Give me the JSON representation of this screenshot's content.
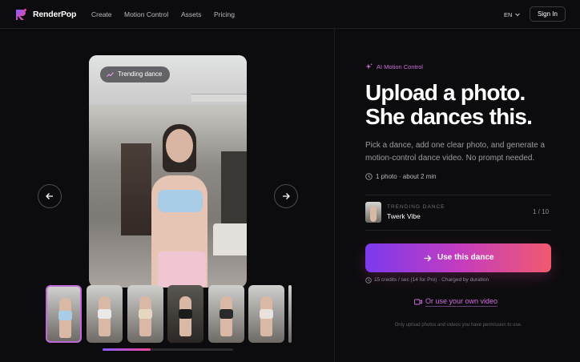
{
  "nav": {
    "brand": "RenderPop",
    "links": [
      "Create",
      "Motion Control",
      "Assets",
      "Pricing"
    ],
    "language": "EN",
    "signin_label": "Sign In"
  },
  "preview": {
    "chip_label": "Trending dance",
    "progress": 0.37
  },
  "hero": {
    "eyebrow": "AI Motion Control",
    "headline_line1": "Upload a photo.",
    "headline_line2": "She dances this.",
    "description": "Pick a dance, add one clear photo, and generate a motion-control dance video. No prompt needed.",
    "meta": "1 photo · about 2 min"
  },
  "selected_dance": {
    "label": "TRENDING DANCE",
    "name": "Twerk Vibe",
    "counter": "1 / 10"
  },
  "cta": {
    "label": "Use this dance",
    "credits": "15 credits / sec (14 for Pro) · Charged by duration"
  },
  "own_video_label": "Or use your own video",
  "disclaimer": "Only upload photos and videos you have permission to use.",
  "colors": {
    "accent": "#d06ee0",
    "cta_start": "#7c3aed",
    "cta_end": "#f15a6e",
    "background": "#0c0c0e"
  }
}
